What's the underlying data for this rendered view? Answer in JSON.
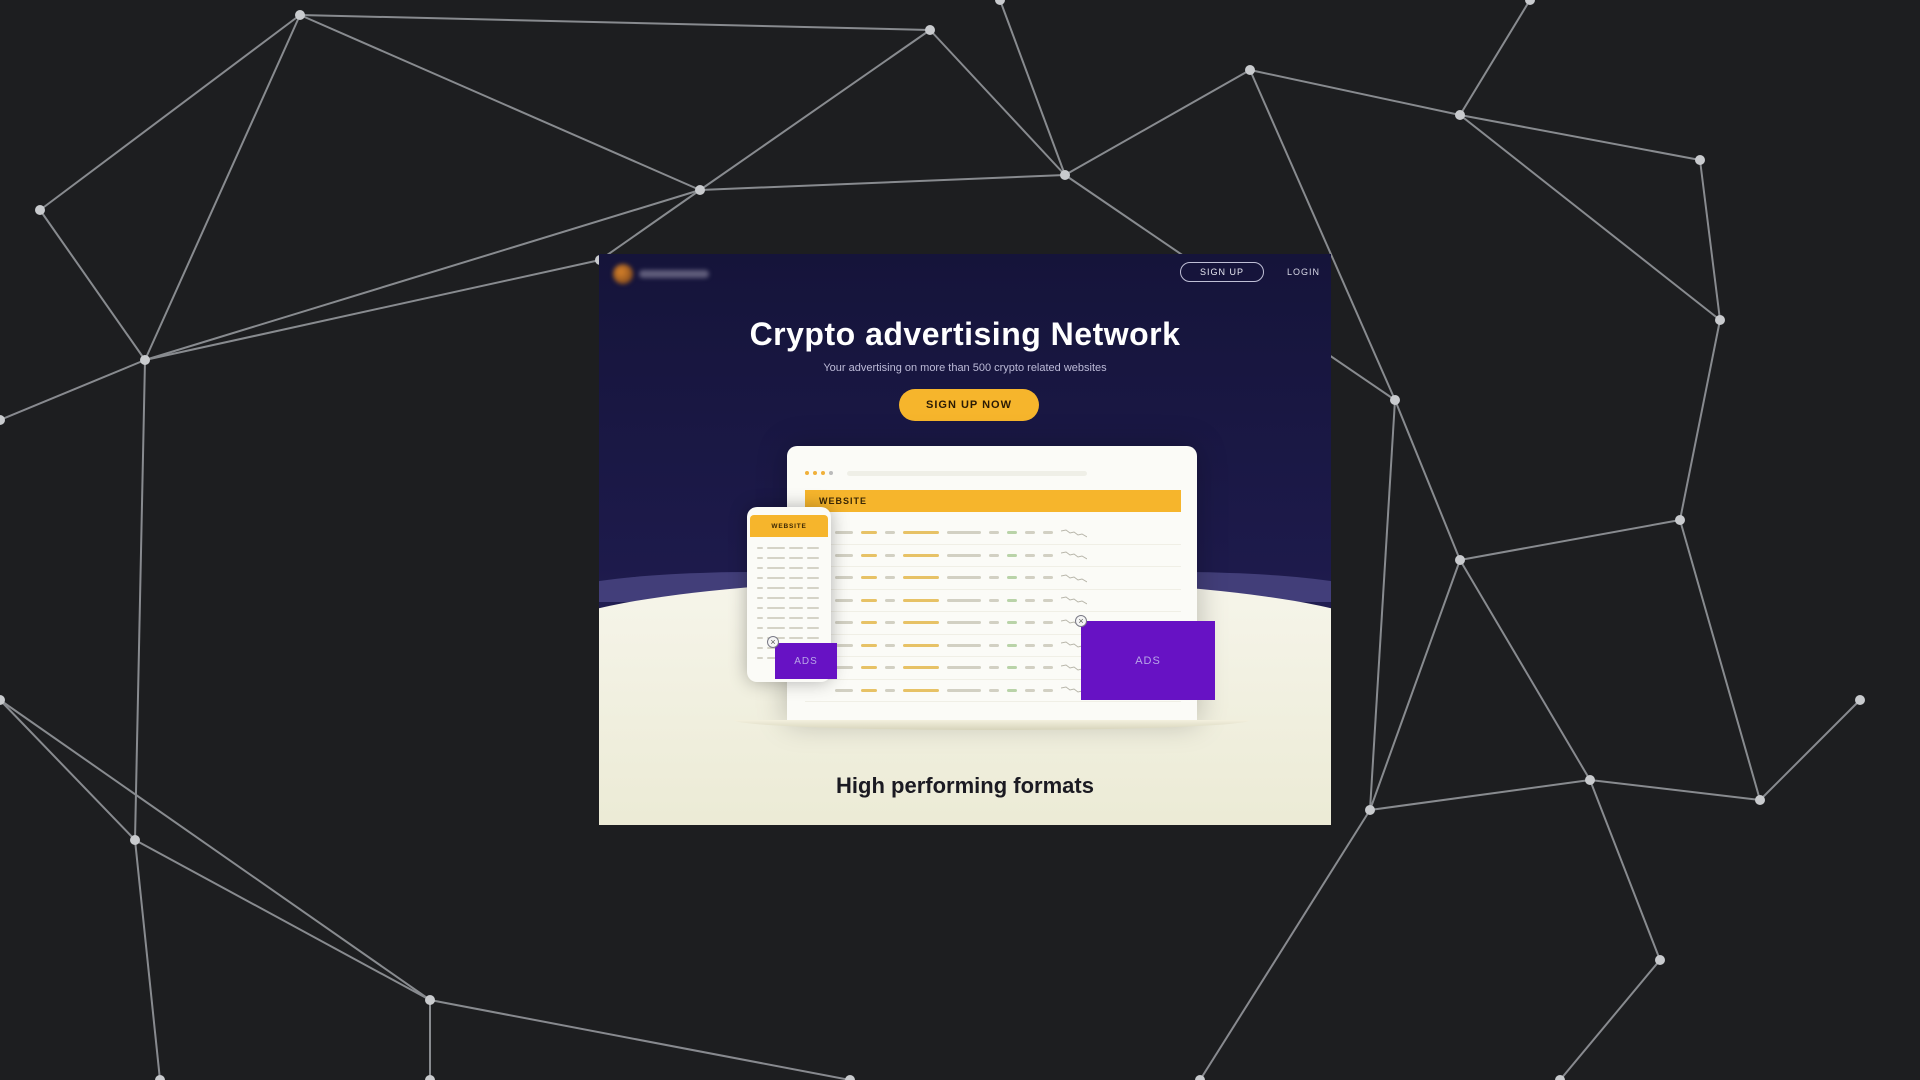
{
  "header": {
    "signup_label": "SIGN UP",
    "login_label": "LOGIN"
  },
  "hero": {
    "title": "Crypto advertising Network",
    "subtitle": "Your advertising on more than 500 crypto related websites",
    "cta_label": "SIGN UP NOW"
  },
  "mockup": {
    "laptop_site_label": "WEBSITE",
    "phone_site_label": "WEBSITE",
    "ad_small_label": "ADS",
    "ad_large_label": "ADS",
    "close_glyph": "×"
  },
  "formats": {
    "title": "High performing formats"
  },
  "colors": {
    "accent": "#f6b52c",
    "ad_purple": "#6712c4",
    "hero_bg": "#15143a",
    "page_bg": "#1d1e20"
  }
}
